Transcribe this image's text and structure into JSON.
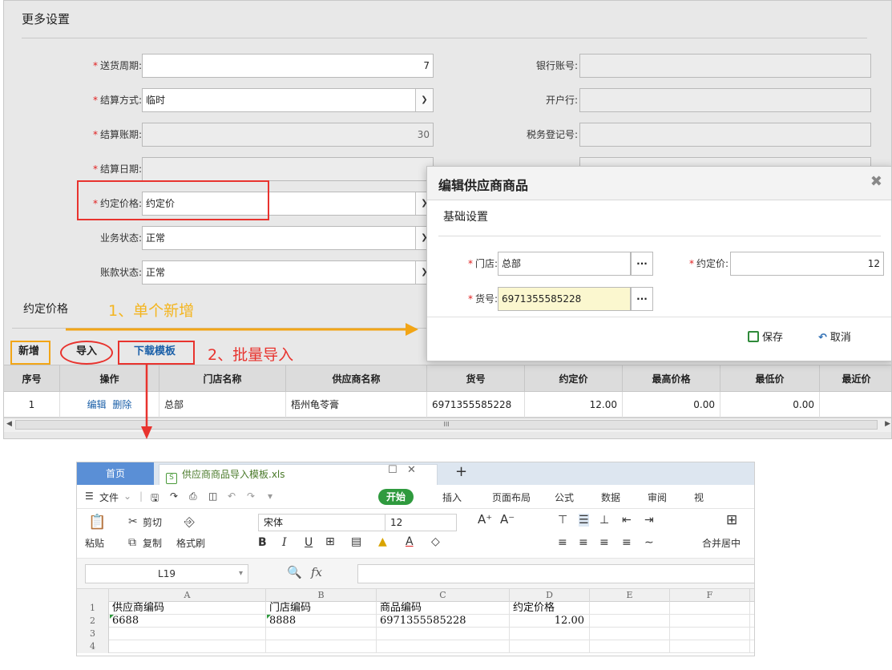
{
  "form": {
    "section_title": "更多设置",
    "delivery_cycle_label": "送货周期:",
    "delivery_cycle_value": "7",
    "settle_method_label": "结算方式:",
    "settle_method_value": "临时",
    "settle_period_label": "结算账期:",
    "settle_period_value": "30",
    "settle_date_label": "结算日期:",
    "agreed_price_label": "约定价格:",
    "agreed_price_value": "约定价",
    "biz_status_label": "业务状态:",
    "biz_status_value": "正常",
    "acct_status_label": "账款状态:",
    "acct_status_value": "正常",
    "bank_account_label": "银行账号:",
    "bank_label": "开户行:",
    "tax_no_label": "税务登记号:",
    "required_mark": "*"
  },
  "price_section": {
    "title": "约定价格",
    "btn_add": "新增",
    "btn_import": "导入",
    "btn_template": "下载模板"
  },
  "grid": {
    "headers": [
      "序号",
      "操作",
      "门店名称",
      "供应商名称",
      "货号",
      "约定价",
      "最高价格",
      "最低价",
      "最近价"
    ],
    "row": {
      "index": "1",
      "edit": "编辑",
      "delete": "删除",
      "store": "总部",
      "supplier": "梧州龟苓膏",
      "sku": "6971355585228",
      "price": "12.00",
      "max": "0.00",
      "min": "0.00"
    },
    "scroll_grip": "III"
  },
  "dialog": {
    "title": "编辑供应商商品",
    "subtitle": "基础设置",
    "store_label": "门店:",
    "store_value": "总部",
    "price_label": "约定价:",
    "price_value": "12",
    "sku_label": "货号:",
    "sku_value": "6971355585228",
    "ellipsis": "···",
    "save": "保存",
    "cancel": "取消"
  },
  "annotations": {
    "single_add": "1、单个新增",
    "batch_import": "2、批量导入"
  },
  "sheet": {
    "tab_home": "首页",
    "file_name": "供应商商品导入模板.xls",
    "menu": [
      "文件",
      "开始",
      "插入",
      "页面布局",
      "公式",
      "数据",
      "审阅",
      "视"
    ],
    "toolbar": {
      "cut": "剪切",
      "paste": "粘贴",
      "copy": "复制",
      "format_painter": "格式刷",
      "font": "宋体",
      "size": "12",
      "merge": "合并居中"
    },
    "cell_ref": "L19",
    "fx": "fx",
    "columns": [
      "A",
      "B",
      "C",
      "D",
      "E",
      "F"
    ],
    "row_numbers": [
      "1",
      "2",
      "3",
      "4"
    ],
    "rows": [
      [
        "供应商编码",
        "门店编码",
        "商品编码",
        "约定价格"
      ],
      [
        "6688",
        "8888",
        "6971355585228",
        "12.00"
      ]
    ]
  },
  "colors": {
    "annotation_red": "#e8332e",
    "annotation_orange": "#f2a516",
    "link_blue": "#1a5fa8",
    "wps_green": "#2f9a3e"
  }
}
